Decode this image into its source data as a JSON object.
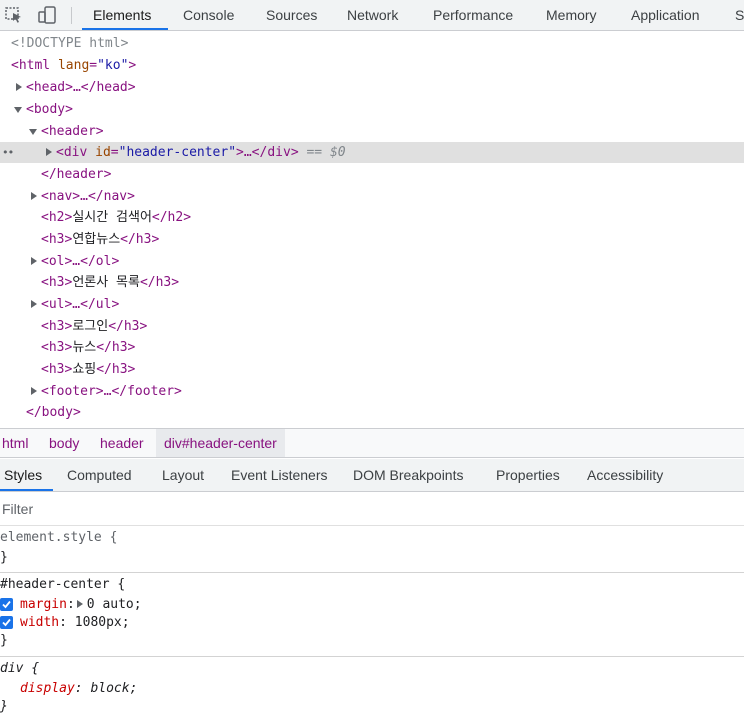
{
  "toolbar": {
    "tabs": [
      "Elements",
      "Console",
      "Sources",
      "Network",
      "Performance",
      "Memory",
      "Application",
      "S"
    ],
    "active_tab": "Elements",
    "icons": [
      "inspect-element-icon",
      "device-toolbar-icon"
    ]
  },
  "dom": {
    "doctype": "<!DOCTYPE html>",
    "html_open": {
      "tag": "<html",
      "attr": "lang",
      "value": "\"ko\"",
      "close": ">"
    },
    "head": "<head>…</head>",
    "body_open": "<body>",
    "header_open": "<header>",
    "selected": {
      "open": "<div",
      "attr": "id",
      "value": "\"header-center\"",
      "rest": ">…</div>",
      "marker": "== ",
      "dollar": "$0"
    },
    "header_close": "</header>",
    "nav": "<nav>…</nav>",
    "h2": {
      "open": "<h2>",
      "text": "실시간 검색어",
      "close": "</h2>"
    },
    "h3_news1": {
      "open": "<h3>",
      "text": "연합뉴스",
      "close": "</h3>"
    },
    "ol": "<ol>…</ol>",
    "h3_press": {
      "open": "<h3>",
      "text": "언론사 목록",
      "close": "</h3>"
    },
    "ul": "<ul>…</ul>",
    "h3_login": {
      "open": "<h3>",
      "text": "로그인",
      "close": "</h3>"
    },
    "h3_news2": {
      "open": "<h3>",
      "text": "뉴스",
      "close": "</h3>"
    },
    "h3_shop": {
      "open": "<h3>",
      "text": "쇼핑",
      "close": "</h3>"
    },
    "footer": "<footer>…</footer>",
    "body_close": "</body>",
    "dots": "••"
  },
  "breadcrumbs": [
    "html",
    "body",
    "header",
    "div#header-center"
  ],
  "subtabs": {
    "items": [
      "Styles",
      "Computed",
      "Layout",
      "Event Listeners",
      "DOM Breakpoints",
      "Properties",
      "Accessibility"
    ],
    "active": "Styles"
  },
  "filter": {
    "placeholder": "Filter",
    "value": ""
  },
  "styles": {
    "element_style": {
      "selector": "element.style {",
      "close": "}"
    },
    "header_center": {
      "selector": "#header-center {",
      "props": [
        {
          "name": "margin",
          "value": "0 auto;",
          "checked": true
        },
        {
          "name": "width",
          "value": "1080px;",
          "checked": true
        }
      ],
      "close": "}"
    },
    "div_rule": {
      "selector": "div {",
      "props": [
        {
          "name": "display",
          "value": "block;"
        }
      ],
      "close": "}"
    }
  },
  "colors": {
    "accent": "#1a73e8",
    "tag": "#881280",
    "attr_name": "#994500",
    "attr_value": "#1a1aa6",
    "prop_name": "#c80000"
  }
}
